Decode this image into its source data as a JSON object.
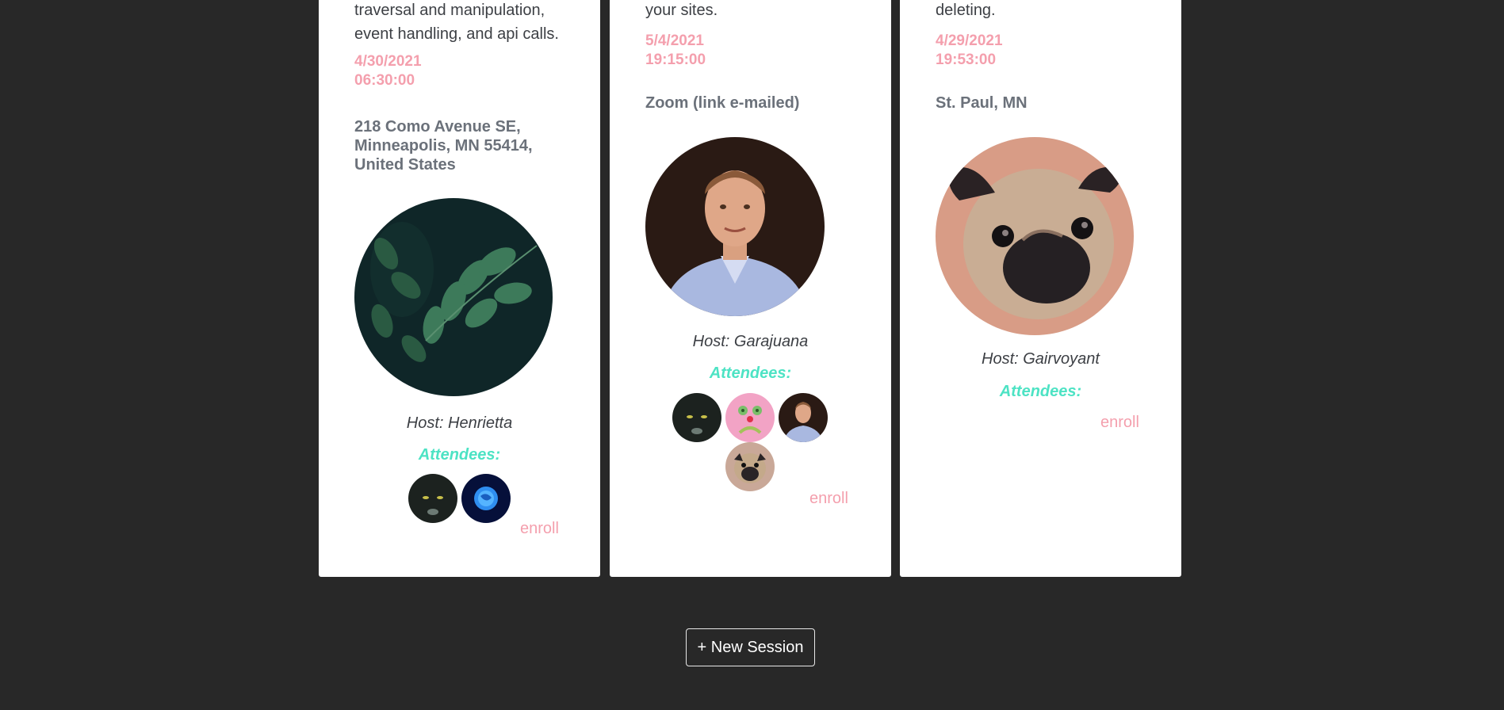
{
  "sessions": [
    {
      "description": "traversal and manipulation, event handling, and api calls.",
      "date": "4/30/2021",
      "time": "06:30:00",
      "location": "218 Como Avenue SE, Minneapolis, MN 55414, United States",
      "photo_icon": "leaves-photo",
      "host": "Host: Henrietta",
      "attendees_label": "Attendees:",
      "attendee_icons": [
        "black-cat-avatar",
        "blue-globe-avatar"
      ],
      "enroll_label": "enroll"
    },
    {
      "description": "your sites.",
      "date": "5/4/2021",
      "time": "19:15:00",
      "location": "Zoom (link e-mailed)",
      "photo_icon": "man-portrait-photo",
      "host": "Host: Garajuana",
      "attendees_label": "Attendees:",
      "attendee_icons": [
        "black-cat-avatar",
        "pink-face-avatar",
        "man-portrait-avatar",
        "pug-avatar"
      ],
      "enroll_label": "enroll"
    },
    {
      "description": "deleting.",
      "date": "4/29/2021",
      "time": "19:53:00",
      "location": "St. Paul, MN",
      "photo_icon": "pug-photo",
      "host": "Host: Gairvoyant",
      "attendees_label": "Attendees:",
      "attendee_icons": [],
      "enroll_label": "enroll"
    }
  ],
  "new_session_label": "+ New Session",
  "colors": {
    "background": "#282828",
    "card": "#ffffff",
    "accent_pink": "#f49fad",
    "accent_teal": "#4de3c4"
  }
}
